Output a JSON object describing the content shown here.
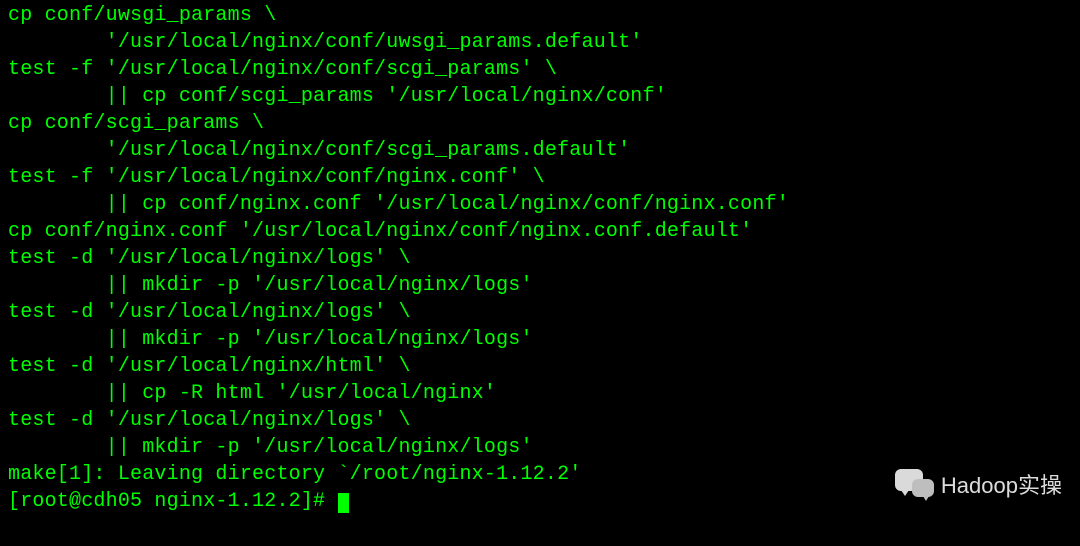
{
  "terminal": {
    "lines": [
      "cp conf/uwsgi_params \\",
      "        '/usr/local/nginx/conf/uwsgi_params.default'",
      "test -f '/usr/local/nginx/conf/scgi_params' \\",
      "        || cp conf/scgi_params '/usr/local/nginx/conf'",
      "cp conf/scgi_params \\",
      "        '/usr/local/nginx/conf/scgi_params.default'",
      "test -f '/usr/local/nginx/conf/nginx.conf' \\",
      "        || cp conf/nginx.conf '/usr/local/nginx/conf/nginx.conf'",
      "cp conf/nginx.conf '/usr/local/nginx/conf/nginx.conf.default'",
      "test -d '/usr/local/nginx/logs' \\",
      "        || mkdir -p '/usr/local/nginx/logs'",
      "test -d '/usr/local/nginx/logs' \\",
      "        || mkdir -p '/usr/local/nginx/logs'",
      "test -d '/usr/local/nginx/html' \\",
      "        || cp -R html '/usr/local/nginx'",
      "test -d '/usr/local/nginx/logs' \\",
      "        || mkdir -p '/usr/local/nginx/logs'",
      "make[1]: Leaving directory `/root/nginx-1.12.2'"
    ],
    "prompt": "[root@cdh05 nginx-1.12.2]#"
  },
  "watermark": {
    "text": "Hadoop实操"
  },
  "colors": {
    "background": "#000000",
    "foreground": "#00ff00",
    "watermark_text": "#efefef"
  }
}
